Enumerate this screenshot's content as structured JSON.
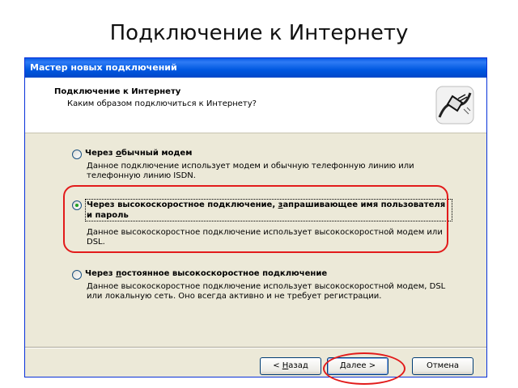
{
  "slide": {
    "title": "Подключение к Интернету"
  },
  "window": {
    "title": "Мастер новых подключений"
  },
  "header": {
    "title": "Подключение к Интернету",
    "subtitle": "Каким образом подключиться к Интернету?",
    "icon": "network-cable-icon"
  },
  "options": [
    {
      "label_pre": "Через ",
      "label_ul": "о",
      "label_post": "бычный модем",
      "description": "Данное подключение использует модем и обычную телефонную линию или телефонную линию ISDN.",
      "selected": false
    },
    {
      "label_pre": "Через высокоскоростное подключение, ",
      "label_ul": "з",
      "label_post": "апрашивающее имя пользователя и пароль",
      "description": "Данное высокоскоростное подключение использует высокоскоростной модем или DSL.",
      "selected": true
    },
    {
      "label_pre": "Через ",
      "label_ul": "п",
      "label_post": "остоянное высокоскоростное подключение",
      "description": "Данное высокоскоростное подключение использует высокоскоростной модем, DSL или локальную сеть. Оно всегда активно и не требует регистрации.",
      "selected": false
    }
  ],
  "buttons": {
    "back_pre": "< ",
    "back_ul": "Н",
    "back_post": "азад",
    "next_pre": "",
    "next_ul": "Д",
    "next_post": "алее >",
    "cancel": "Отмена"
  },
  "colors": {
    "titlebar": "#0058e0",
    "annotation": "#e21b1b",
    "dialog_bg": "#ece9d8"
  }
}
